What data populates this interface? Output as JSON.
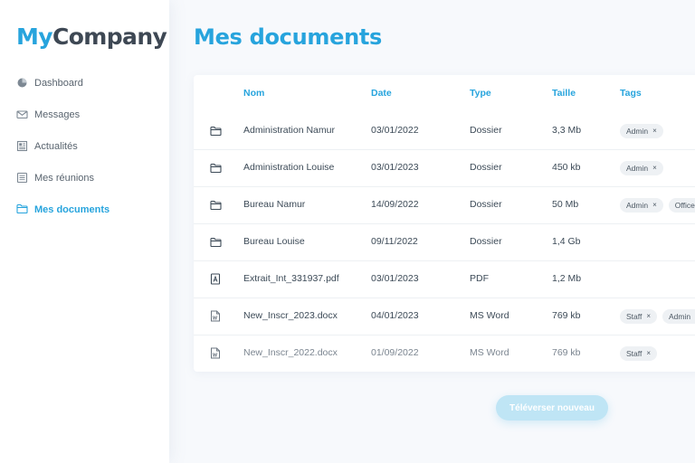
{
  "brand": {
    "part1": "My",
    "part2": "Company"
  },
  "colors": {
    "accent": "#27a4dd",
    "text": "#3c4a57",
    "tag_bg": "#eef1f4"
  },
  "sidebar": {
    "items": [
      {
        "label": "Dashboard",
        "icon": "pie-chart-icon",
        "active": false
      },
      {
        "label": "Messages",
        "icon": "envelope-icon",
        "active": false
      },
      {
        "label": "Actualités",
        "icon": "newspaper-icon",
        "active": false
      },
      {
        "label": "Mes réunions",
        "icon": "list-icon",
        "active": false
      },
      {
        "label": "Mes documents",
        "icon": "folder-icon",
        "active": true
      }
    ]
  },
  "main": {
    "title": "Mes documents",
    "columns": {
      "nom": "Nom",
      "date": "Date",
      "type": "Type",
      "taille": "Taille",
      "tags": "Tags"
    },
    "rows": [
      {
        "icon": "folder-icon",
        "nom": "Administration Namur",
        "date": "03/01/2022",
        "type": "Dossier",
        "taille": "3,3 Mb",
        "tags": [
          "Admin"
        ]
      },
      {
        "icon": "folder-icon",
        "nom": "Administration Louise",
        "date": "03/01/2023",
        "type": "Dossier",
        "taille": "450 kb",
        "tags": [
          "Admin"
        ]
      },
      {
        "icon": "folder-icon",
        "nom": "Bureau Namur",
        "date": "14/09/2022",
        "type": "Dossier",
        "taille": "50 Mb",
        "tags": [
          "Admin",
          "Office"
        ]
      },
      {
        "icon": "folder-icon",
        "nom": "Bureau Louise",
        "date": "09/11/2022",
        "type": "Dossier",
        "taille": "1,4 Gb",
        "tags": []
      },
      {
        "icon": "pdf-file-icon",
        "nom": "Extrait_Int_331937.pdf",
        "date": "03/01/2023",
        "type": "PDF",
        "taille": "1,2 Mb",
        "tags": []
      },
      {
        "icon": "word-file-icon",
        "nom": "New_Inscr_2023.docx",
        "date": "04/01/2023",
        "type": "MS Word",
        "taille": "769 kb",
        "tags": [
          "Staff",
          "Admin"
        ]
      },
      {
        "icon": "word-file-icon",
        "nom": "New_Inscr_2022.docx",
        "date": "01/09/2022",
        "type": "MS Word",
        "taille": "769 kb",
        "tags": [
          "Staff"
        ]
      }
    ],
    "tag_remove_glyph": "×",
    "upload_label": "Téléverser nouveau"
  }
}
